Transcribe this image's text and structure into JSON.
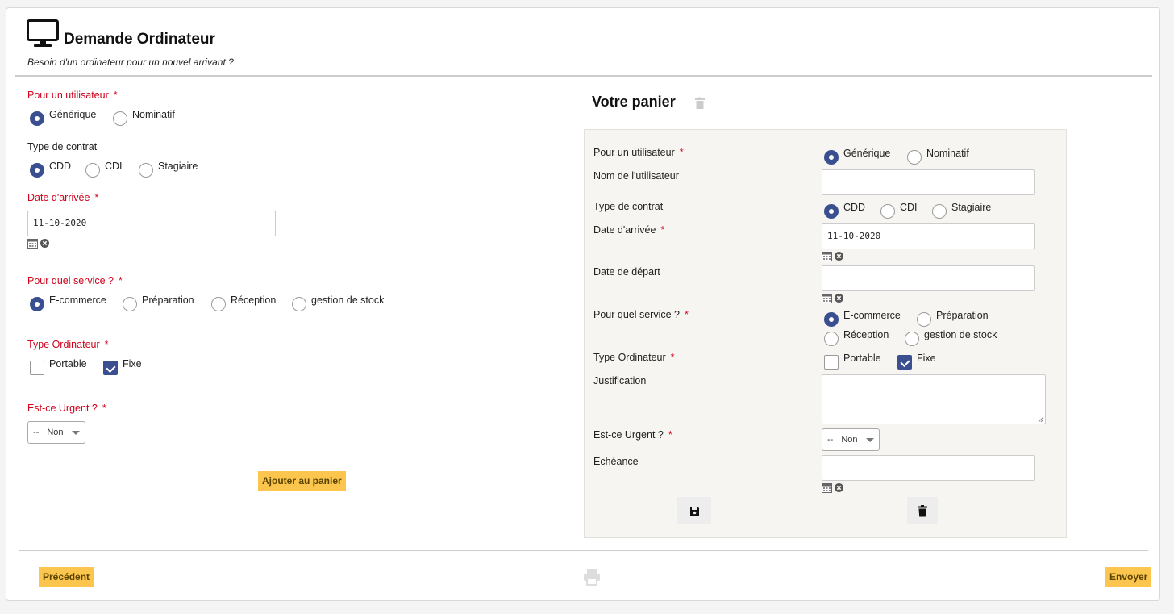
{
  "header": {
    "title": "Demande Ordinateur",
    "subtitle": "Besoin d'un ordinateur pour un nouvel arrivant ?",
    "icon": "monitor-icon"
  },
  "form": {
    "user": {
      "label": "Pour un utilisateur",
      "required_mark": "*",
      "options": [
        "Générique",
        "Nominatif"
      ],
      "selected": "Générique"
    },
    "contract": {
      "label": "Type de contrat",
      "options": [
        "CDD",
        "CDI",
        "Stagiaire"
      ],
      "selected": "CDD"
    },
    "arrival": {
      "label": "Date d'arrivée",
      "required_mark": "*",
      "value": "11-10-2020"
    },
    "service": {
      "label": "Pour quel service ?",
      "required_mark": "*",
      "options": [
        "E-commerce",
        "Préparation",
        "Réception",
        "gestion de stock"
      ],
      "selected": "E-commerce"
    },
    "computer_type": {
      "label": "Type Ordinateur",
      "required_mark": "*",
      "options": [
        "Portable",
        "Fixe"
      ],
      "checked": [
        "Fixe"
      ]
    },
    "urgent": {
      "label": "Est-ce Urgent ?",
      "required_mark": "*",
      "prefix": "--",
      "value": "Non"
    },
    "add_button": "Ajouter au panier"
  },
  "cart": {
    "title": "Votre panier",
    "user": {
      "label": "Pour un utilisateur",
      "required_mark": "*",
      "options": [
        "Générique",
        "Nominatif"
      ],
      "selected": "Générique"
    },
    "user_name": {
      "label": "Nom de l'utilisateur",
      "value": ""
    },
    "contract": {
      "label": "Type de contrat",
      "options": [
        "CDD",
        "CDI",
        "Stagiaire"
      ],
      "selected": "CDD"
    },
    "arrival": {
      "label": "Date d'arrivée",
      "required_mark": "*",
      "value": "11-10-2020"
    },
    "departure": {
      "label": "Date de départ",
      "value": ""
    },
    "service": {
      "label": "Pour quel service ?",
      "required_mark": "*",
      "options": [
        "E-commerce",
        "Préparation",
        "Réception",
        "gestion de stock"
      ],
      "selected": "E-commerce"
    },
    "computer_type": {
      "label": "Type Ordinateur",
      "required_mark": "*",
      "options": [
        "Portable",
        "Fixe"
      ],
      "checked": [
        "Fixe"
      ]
    },
    "justification": {
      "label": "Justification",
      "value": ""
    },
    "urgent": {
      "label": "Est-ce Urgent ?",
      "required_mark": "*",
      "prefix": "--",
      "value": "Non"
    },
    "deadline": {
      "label": "Echéance",
      "value": ""
    }
  },
  "footer": {
    "previous": "Précédent",
    "send": "Envoyer"
  },
  "colors": {
    "accent": "#3a4f8f",
    "required": "#d0021b",
    "button": "#fcc64e",
    "panel_bg": "#f6f5f1"
  }
}
